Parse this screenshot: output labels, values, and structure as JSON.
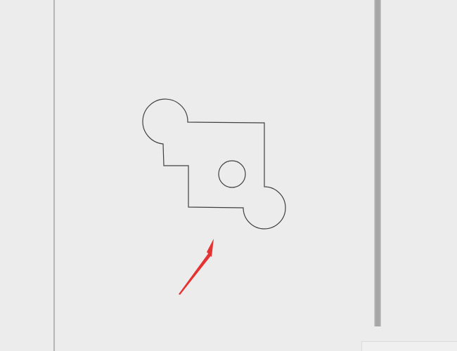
{
  "canvas": {
    "background_color": "#ececec",
    "stroke_color": "#404040",
    "arrow_color": "#e53333"
  },
  "drawing": {
    "shape_icon": "gear-outline-shape",
    "arrow_icon": "red-pointer-arrow-icon"
  }
}
